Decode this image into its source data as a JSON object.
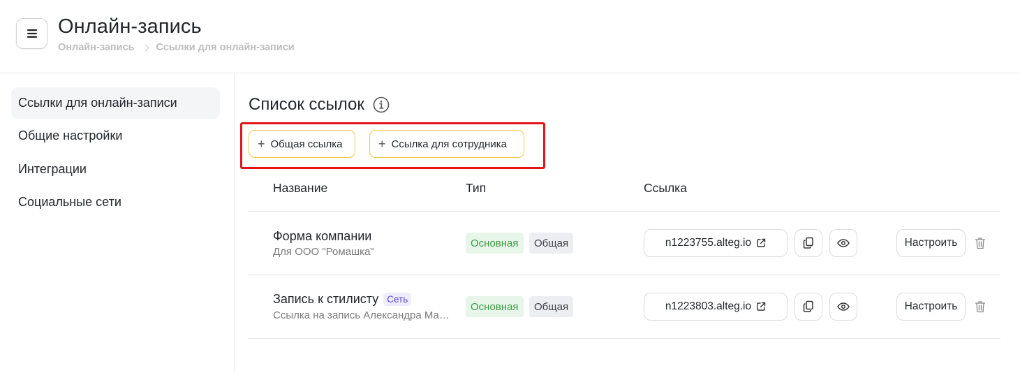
{
  "header": {
    "title": "Онлайн-запись",
    "breadcrumb": [
      "Онлайн-запись",
      "Ссылки для онлайн-записи"
    ]
  },
  "sidebar": {
    "items": [
      {
        "label": "Ссылки для онлайн-записи",
        "active": true
      },
      {
        "label": "Общие настройки",
        "active": false
      },
      {
        "label": "Интеграции",
        "active": false
      },
      {
        "label": "Социальные сети",
        "active": false
      }
    ]
  },
  "main": {
    "section_title": "Список ссылок",
    "buttons": {
      "common_link": "Общая ссылка",
      "employee_link": "Ссылка для сотрудника"
    },
    "columns": [
      "Название",
      "Тип",
      "Ссылка"
    ],
    "rows": [
      {
        "name": "Форма компании",
        "subtitle": "Для ООО \"Ромашка\"",
        "badge": "",
        "tags": [
          "Основная",
          "Общая"
        ],
        "link": "n1223755.alteg.io",
        "configure": "Настроить"
      },
      {
        "name": "Запись к стилисту",
        "subtitle": "Ссылка на запись Александра Маркова",
        "badge": "Сеть",
        "tags": [
          "Основная",
          "Общая"
        ],
        "link": "n1223803.alteg.io",
        "configure": "Настроить"
      }
    ]
  },
  "colors": {
    "accent_border": "#f0c94a",
    "highlight": "#e4141b",
    "tag_main_bg": "#e8f6e9",
    "tag_main_text": "#3c9a45",
    "badge_text": "#5b4bd6"
  }
}
